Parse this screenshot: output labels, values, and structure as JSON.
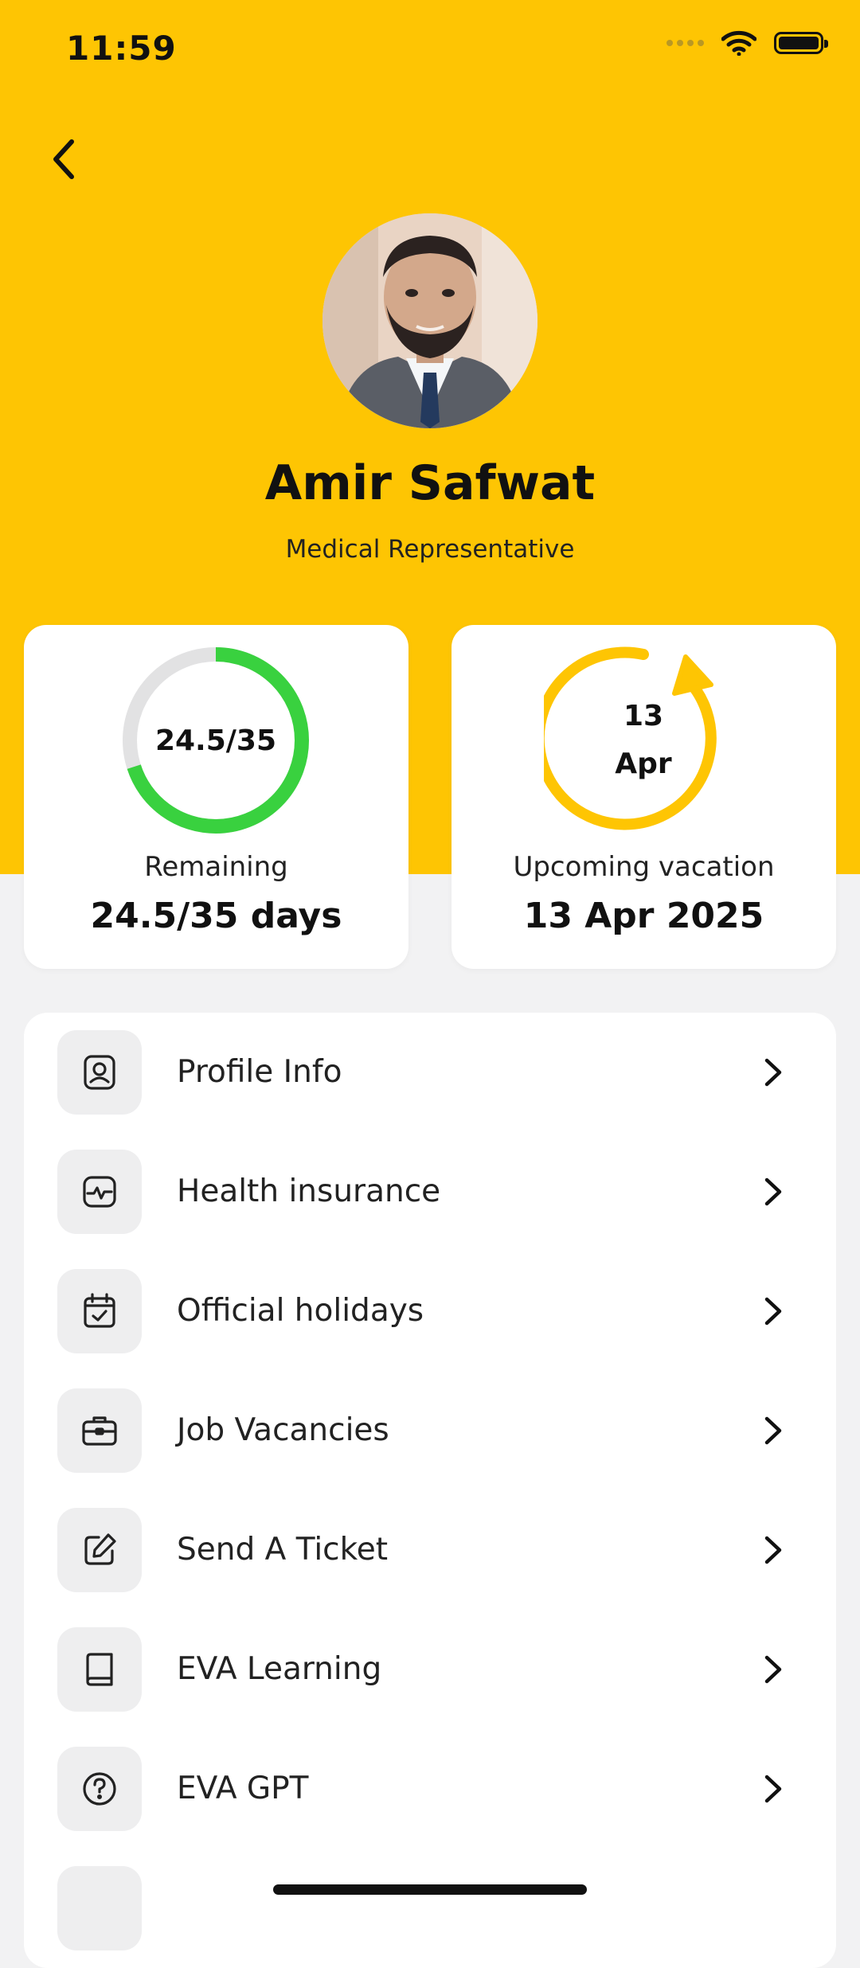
{
  "status_bar": {
    "time": "11:59"
  },
  "header": {
    "back_icon": "chevron-left-icon",
    "name": "Amir Safwat",
    "role": "Medical Representative"
  },
  "stats": {
    "remaining": {
      "ring_text": "24.5/35",
      "label": "Remaining",
      "value": "24.5/35 days",
      "used": 10.5,
      "total": 35,
      "ring_color": "#39D13F"
    },
    "vacation": {
      "ring_day": "13",
      "ring_month": "Apr",
      "label": "Upcoming vacation",
      "value": "13 Apr 2025",
      "ring_color": "#FEC503"
    }
  },
  "menu": {
    "items": [
      {
        "label": "Profile Info",
        "icon": "user-badge-icon"
      },
      {
        "label": "Health insurance",
        "icon": "heart-monitor-icon"
      },
      {
        "label": "Official holidays",
        "icon": "calendar-check-icon"
      },
      {
        "label": "Job Vacancies",
        "icon": "briefcase-icon"
      },
      {
        "label": "Send A Ticket",
        "icon": "edit-icon"
      },
      {
        "label": "EVA Learning",
        "icon": "book-icon"
      },
      {
        "label": "EVA GPT",
        "icon": "help-circle-icon"
      }
    ]
  },
  "colors": {
    "brand": "#FEC503",
    "progress": "#39D13F",
    "background": "#F2F2F3"
  }
}
